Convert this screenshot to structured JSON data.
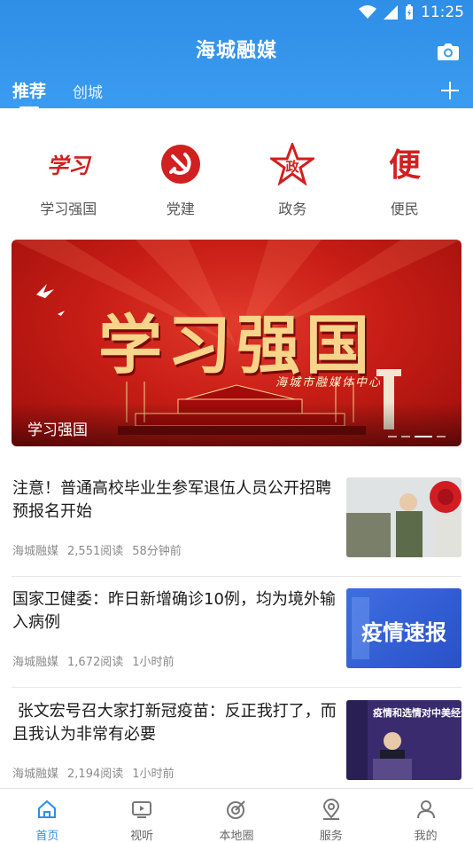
{
  "status_bar": {
    "time": "11:25"
  },
  "header": {
    "title": "海城融媒",
    "tabs": [
      {
        "label": "推荐",
        "active": true
      },
      {
        "label": "创城",
        "active": false
      }
    ]
  },
  "categories": [
    {
      "label": "学习强国",
      "icon": "xuexi-logo-icon"
    },
    {
      "label": "党建",
      "icon": "party-emblem-icon"
    },
    {
      "label": "政务",
      "icon": "star-zheng-icon"
    },
    {
      "label": "便民",
      "icon": "bian-icon"
    }
  ],
  "banner": {
    "caption": "学习强国",
    "artwork_title": "学习强国",
    "artwork_subtitle": "海城市融媒体中心",
    "slide_count": 4,
    "active_slide": 3
  },
  "news": [
    {
      "title": "注意！普通高校毕业生参军退伍人员公开招聘预报名开始",
      "source": "海城融媒",
      "reads": "2,551阅读",
      "time": "58分钟前"
    },
    {
      "title": "国家卫健委：昨日新增确诊10例，均为境外输入病例",
      "source": "海城融媒",
      "reads": "1,672阅读",
      "time": "1小时前",
      "thumb_text": "疫情速报"
    },
    {
      "title": "张文宏号召大家打新冠疫苗：反正我打了，而且我认为非常有必要",
      "source": "海城融媒",
      "reads": "2,194阅读",
      "time": "1小时前",
      "thumb_text": "疫情和选情对中美经济"
    }
  ],
  "bottom_nav": [
    {
      "label": "首页",
      "icon": "home-icon",
      "active": true
    },
    {
      "label": "视听",
      "icon": "tv-icon",
      "active": false
    },
    {
      "label": "本地圈",
      "icon": "target-icon",
      "active": false
    },
    {
      "label": "服务",
      "icon": "location-icon",
      "active": false
    },
    {
      "label": "我的",
      "icon": "user-icon",
      "active": false
    }
  ],
  "colors": {
    "brand_blue": "#2f8ee6",
    "red": "#c81e16",
    "gold": "#f6d58a"
  }
}
